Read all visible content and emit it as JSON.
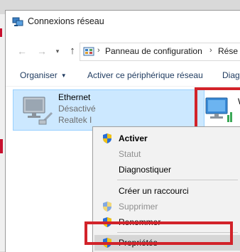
{
  "window": {
    "title": "Connexions réseau"
  },
  "address": {
    "back_icon": "arrow-left-icon",
    "forward_icon": "arrow-right-icon",
    "up_icon": "arrow-up-icon",
    "crumbs": [
      "Panneau de configuration",
      "Rése"
    ],
    "separator": "›"
  },
  "commands": {
    "organize": "Organiser",
    "activate_device": "Activer ce périphérique réseau",
    "diagnose": "Diagn"
  },
  "connections": [
    {
      "name": "Ethernet",
      "status": "Désactivé",
      "device": "Realtek I",
      "selected": true
    },
    {
      "name": "W",
      "status": "",
      "device": "",
      "selected": false
    }
  ],
  "context_menu": {
    "items": [
      {
        "label": "Activer",
        "bold": true,
        "disabled": false,
        "shield": true
      },
      {
        "label": "Statut",
        "bold": false,
        "disabled": true,
        "shield": false
      },
      {
        "label": "Diagnostiquer",
        "bold": false,
        "disabled": false,
        "shield": false
      },
      {
        "label": "Créer un raccourci",
        "bold": false,
        "disabled": false,
        "shield": false
      },
      {
        "label": "Supprimer",
        "bold": false,
        "disabled": true,
        "shield": true
      },
      {
        "label": "Renommer",
        "bold": false,
        "disabled": false,
        "shield": true
      },
      {
        "label": "Propriétés",
        "bold": false,
        "disabled": false,
        "shield": true,
        "hover": true
      }
    ]
  },
  "colors": {
    "selection_bg": "#cce8ff",
    "annotation_red": "#d2232a",
    "menu_bg": "#f2f2f2"
  }
}
